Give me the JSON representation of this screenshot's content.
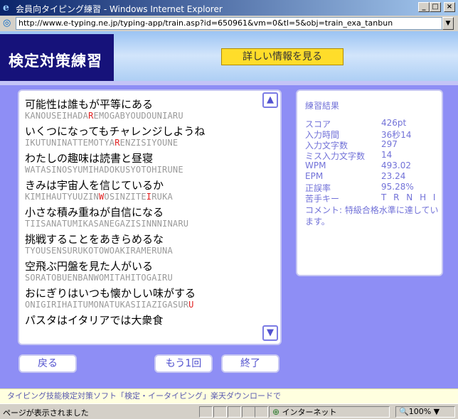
{
  "window": {
    "title": "会員向タイピング練習 - Windows Internet Explorer",
    "address": "http://www.e-typing.ne.jp/typing-app/train.asp?id=650961&vm=0&tl=5&obj=train_exa_tanbun"
  },
  "header": {
    "logo": "検定対策練習",
    "info_button": "詳しい情報を見る"
  },
  "practice": {
    "lines": [
      {
        "jp": "可能性は誰もが平等にある",
        "ro_before": "KANOUSEIHADA",
        "ro_miss": "R",
        "ro_after": "EMOGABYOUDOUNIARU"
      },
      {
        "jp": "いくつになってもチャレンジしようね",
        "ro_before": "IKUTUNINATTEMOTYA",
        "ro_miss": "R",
        "ro_after": "ENZISIYOUNE"
      },
      {
        "jp": "わたしの趣味は読書と昼寝",
        "ro_before": "WATASINOSYUMIHADOKUSYOTOHIRUNE",
        "ro_miss": "",
        "ro_after": ""
      },
      {
        "jp": "きみは宇宙人を信じているか",
        "ro_before": "KIMIHAUTYUUZIN",
        "ro_miss": "W",
        "ro_after": "OSINZITE",
        "ro_miss2": "I",
        "ro_after2": "RUKA"
      },
      {
        "jp": "小さな積み重ねが自信になる",
        "ro_before": "TIISANATUMIKASANEGAZISINNNINARU",
        "ro_miss": "",
        "ro_after": ""
      },
      {
        "jp": "挑戦することをあきらめるな",
        "ro_before": "TYOUSENSURUKOTOWOAKIRAMERUNA",
        "ro_miss": "",
        "ro_after": ""
      },
      {
        "jp": "空飛ぶ円盤を見た人がいる",
        "ro_before": "SORATOBUENBANWOMITAHITOGAIRU",
        "ro_miss": "",
        "ro_after": ""
      },
      {
        "jp": "おにぎりはいつも懐かしい味がする",
        "ro_before": "ONIGIRIHAITUMONATUKASIIAZIGASUR",
        "ro_miss": "U",
        "ro_after": ""
      },
      {
        "jp": "パスタはイタリアでは大衆食"
      }
    ]
  },
  "result": {
    "title": "練習結果",
    "rows": [
      {
        "label": "スコア",
        "value": "426pt"
      },
      {
        "label": "入力時間",
        "value": "36秒14"
      },
      {
        "label": "入力文字数",
        "value": "297"
      },
      {
        "label": "ミス入力文字数",
        "value": "14"
      },
      {
        "label": "WPM",
        "value": "493.02"
      },
      {
        "label": "EPM",
        "value": "23.24"
      },
      {
        "label": "正誤率",
        "value": "95.28%"
      },
      {
        "label": "苦手キー",
        "value": "T R N H I"
      }
    ],
    "comment": "コメント: 特級合格水準に達しています。"
  },
  "buttons": {
    "back": "戻る",
    "again": "もう1回",
    "end": "終了"
  },
  "footer": {
    "ad": "タイピング技能検定対策ソフト「検定・イータイピング」楽天ダウンロードで"
  },
  "status": {
    "text": "ページが表示されました",
    "zone": "インターネット",
    "zoom": "100%"
  }
}
